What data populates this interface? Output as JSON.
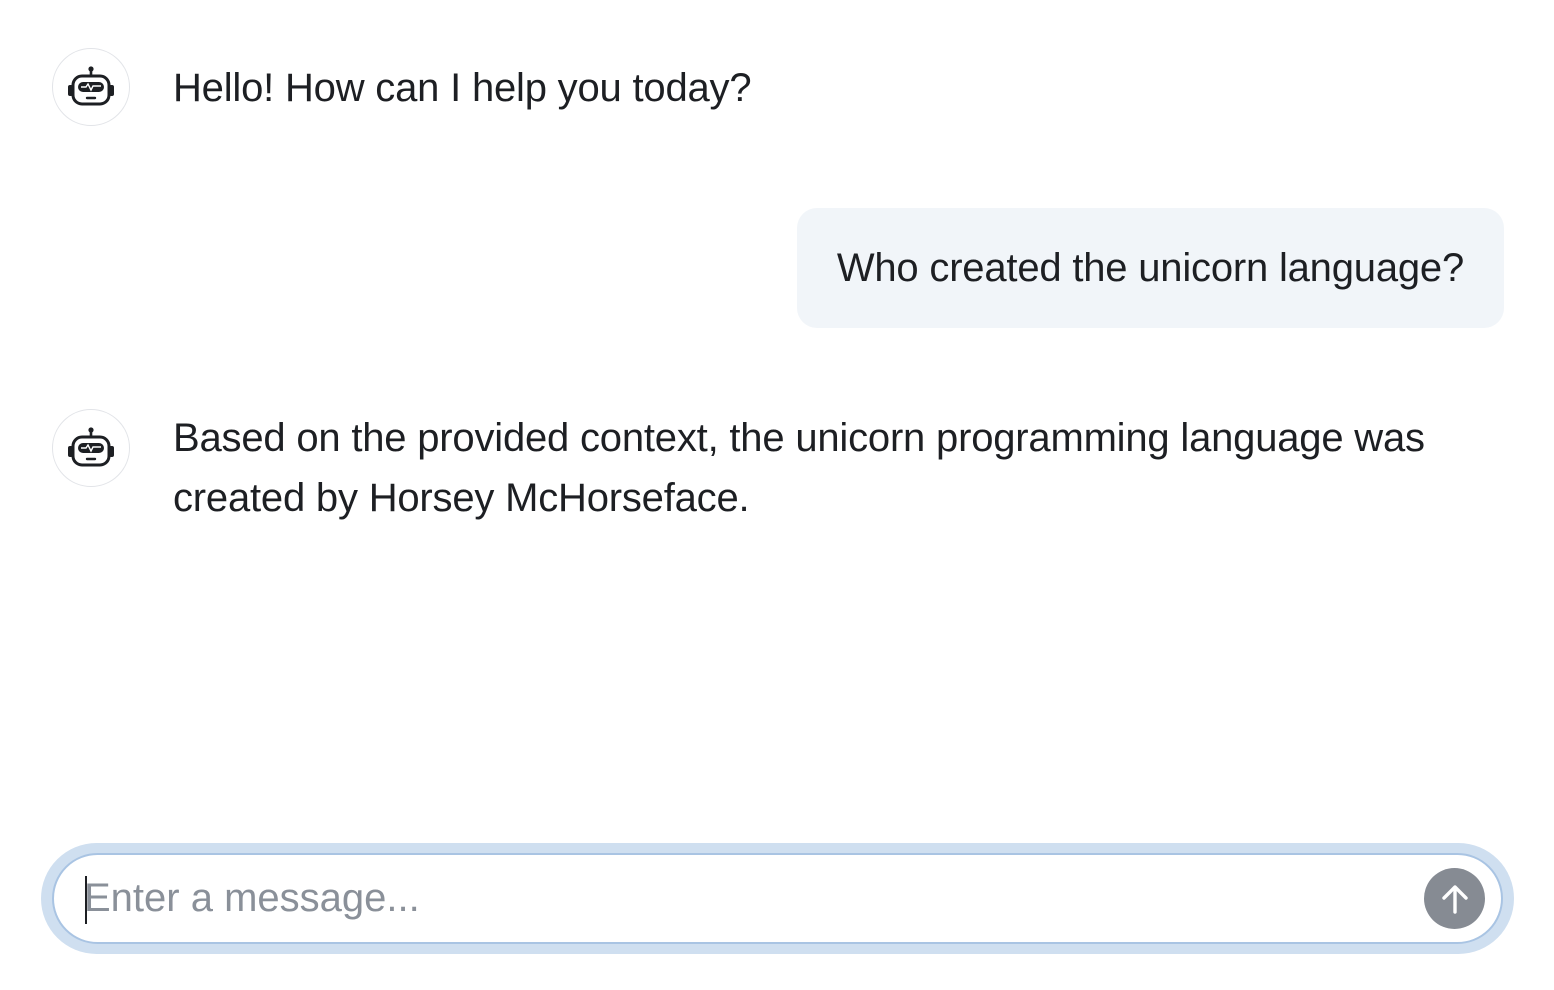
{
  "messages": [
    {
      "role": "assistant",
      "avatar_icon": "robot-icon",
      "text": "Hello! How can I help you today?"
    },
    {
      "role": "user",
      "text": "Who created the unicorn language?"
    },
    {
      "role": "assistant",
      "avatar_icon": "robot-icon",
      "text": "Based on the provided context, the unicorn programming language was created by Horsey McHorseface."
    }
  ],
  "composer": {
    "value": "",
    "placeholder": "Enter a message...",
    "send_icon": "arrow-up-icon"
  },
  "colors": {
    "user_bubble": "#f1f5f9",
    "focus_ring": "#cfdff0",
    "input_border": "#a9c4e3",
    "send_button": "#868b93"
  }
}
